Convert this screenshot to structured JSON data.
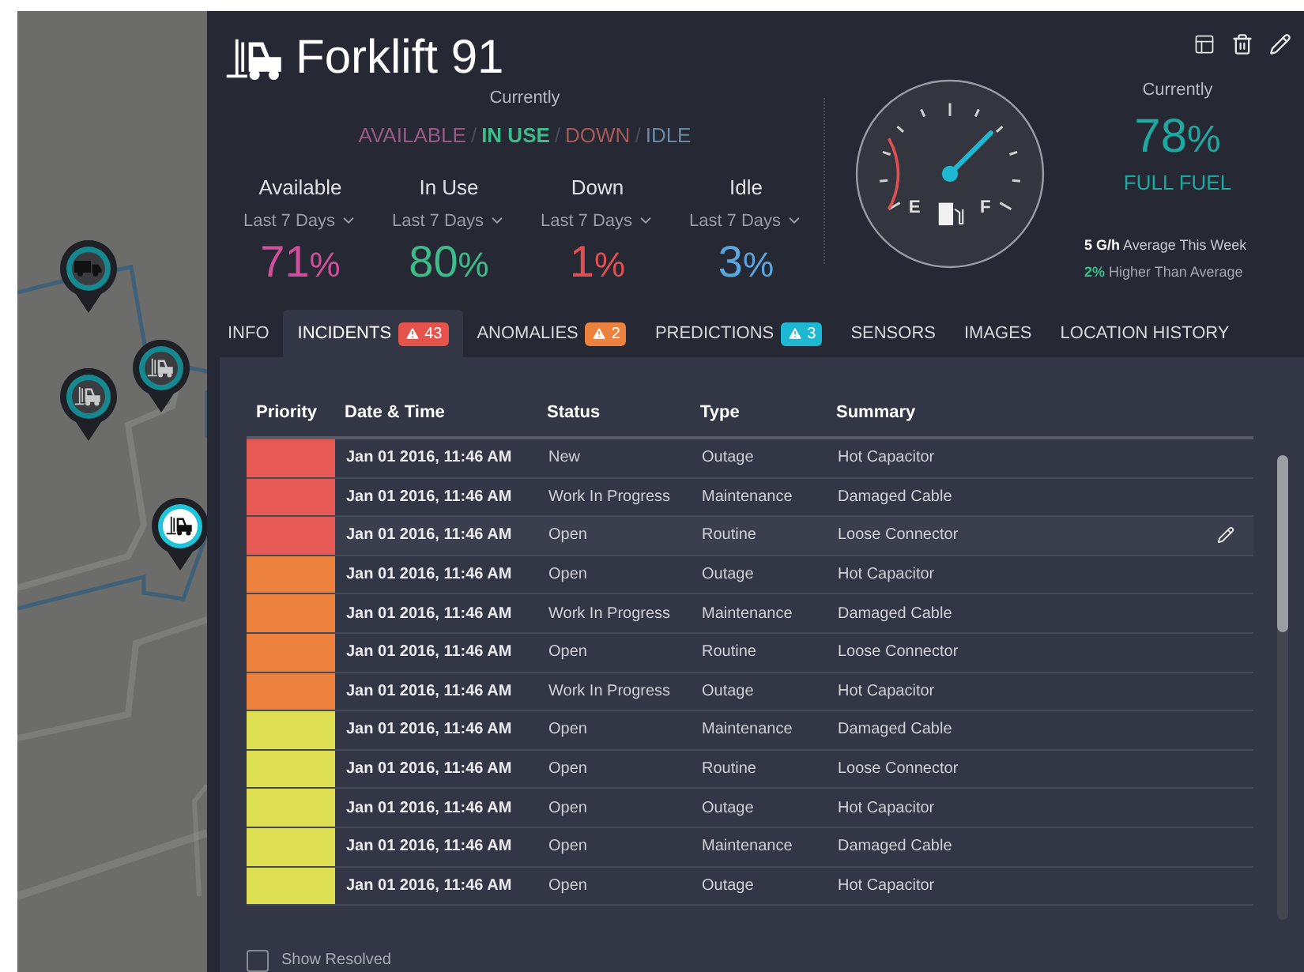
{
  "header": {
    "title": "Forklift 91",
    "currently_label": "Currently"
  },
  "status_options": [
    {
      "label": "AVAILABLE",
      "selected": false,
      "color": "#9a5a86"
    },
    {
      "label": "IN USE",
      "selected": true,
      "color": "#3dbb8a"
    },
    {
      "label": "DOWN",
      "selected": false,
      "color": "#a85a5a"
    },
    {
      "label": "IDLE",
      "selected": false,
      "color": "#6a8aa6"
    }
  ],
  "status_separator": "/",
  "stats": [
    {
      "label": "Available",
      "period": "Last 7 Days",
      "value": "71",
      "unit": "%",
      "color": "#d04f9a"
    },
    {
      "label": "In Use",
      "period": "Last 7 Days",
      "value": "80",
      "unit": "%",
      "color": "#3dbb8a"
    },
    {
      "label": "Down",
      "period": "Last 7 Days",
      "value": "1",
      "unit": "%",
      "color": "#e05050"
    },
    {
      "label": "Idle",
      "period": "Last 7 Days",
      "value": "3",
      "unit": "%",
      "color": "#5aa7e0"
    }
  ],
  "fuel": {
    "empty_label": "E",
    "full_label": "F",
    "currently_label": "Currently",
    "value": "78",
    "unit": "%",
    "caption": "FULL FUEL",
    "average_value": "5 G/h",
    "average_text": "Average This Week",
    "compare_value": "2%",
    "compare_text": "Higher Than Average"
  },
  "tabs": [
    {
      "label": "INFO",
      "selected": false
    },
    {
      "label": "INCIDENTS",
      "selected": true,
      "badge": "43",
      "color": "#e5534b"
    },
    {
      "label": "ANOMALIES",
      "selected": false,
      "badge": "2",
      "color": "#ec823d"
    },
    {
      "label": "PREDICTIONS",
      "selected": false,
      "badge": "3",
      "color": "#1fb8d3"
    },
    {
      "label": "SENSORS",
      "selected": false
    },
    {
      "label": "IMAGES",
      "selected": false
    },
    {
      "label": "LOCATION HISTORY",
      "selected": false
    }
  ],
  "table": {
    "columns": [
      "Priority",
      "Date & Time",
      "Status",
      "Type",
      "Summary"
    ],
    "rows": [
      {
        "color": "#e85a55",
        "date": "Jan 01 2016, 11:46 AM",
        "status": "New",
        "type": "Outage",
        "summary": "Hot Capacitor",
        "selected": false
      },
      {
        "color": "#e85a55",
        "date": "Jan 01 2016, 11:46 AM",
        "status": "Work In Progress",
        "type": "Maintenance",
        "summary": "Damaged Cable",
        "selected": false
      },
      {
        "color": "#e85a55",
        "date": "Jan 01 2016, 11:46 AM",
        "status": "Open",
        "type": "Routine",
        "summary": "Loose Connector",
        "selected": true
      },
      {
        "color": "#ec823d",
        "date": "Jan 01 2016, 11:46 AM",
        "status": "Open",
        "type": "Outage",
        "summary": "Hot Capacitor",
        "selected": false
      },
      {
        "color": "#ec823d",
        "date": "Jan 01 2016, 11:46 AM",
        "status": "Work In Progress",
        "type": "Maintenance",
        "summary": "Damaged Cable",
        "selected": false
      },
      {
        "color": "#ec823d",
        "date": "Jan 01 2016, 11:46 AM",
        "status": "Open",
        "type": "Routine",
        "summary": "Loose Connector",
        "selected": false
      },
      {
        "color": "#ec823d",
        "date": "Jan 01 2016, 11:46 AM",
        "status": "Work In Progress",
        "type": "Outage",
        "summary": "Hot Capacitor",
        "selected": false
      },
      {
        "color": "#dede52",
        "date": "Jan 01 2016, 11:46 AM",
        "status": "Open",
        "type": "Maintenance",
        "summary": "Damaged Cable",
        "selected": false
      },
      {
        "color": "#dede52",
        "date": "Jan 01 2016, 11:46 AM",
        "status": "Open",
        "type": "Routine",
        "summary": "Loose Connector",
        "selected": false
      },
      {
        "color": "#dede52",
        "date": "Jan 01 2016, 11:46 AM",
        "status": "Open",
        "type": "Outage",
        "summary": "Hot Capacitor",
        "selected": false
      },
      {
        "color": "#dede52",
        "date": "Jan 01 2016, 11:46 AM",
        "status": "Open",
        "type": "Maintenance",
        "summary": "Damaged Cable",
        "selected": false
      },
      {
        "color": "#dede52",
        "date": "Jan 01 2016, 11:46 AM",
        "status": "Open",
        "type": "Outage",
        "summary": "Hot Capacitor",
        "selected": false
      }
    ]
  },
  "show_resolved": {
    "label": "Show Resolved",
    "checked": false
  },
  "map": {
    "kind": "picture",
    "pins": [
      {
        "kind": "truck",
        "selected": false
      },
      {
        "kind": "forklift",
        "selected": false
      },
      {
        "kind": "forklift",
        "selected": false
      },
      {
        "kind": "forklift",
        "selected": true
      }
    ]
  }
}
